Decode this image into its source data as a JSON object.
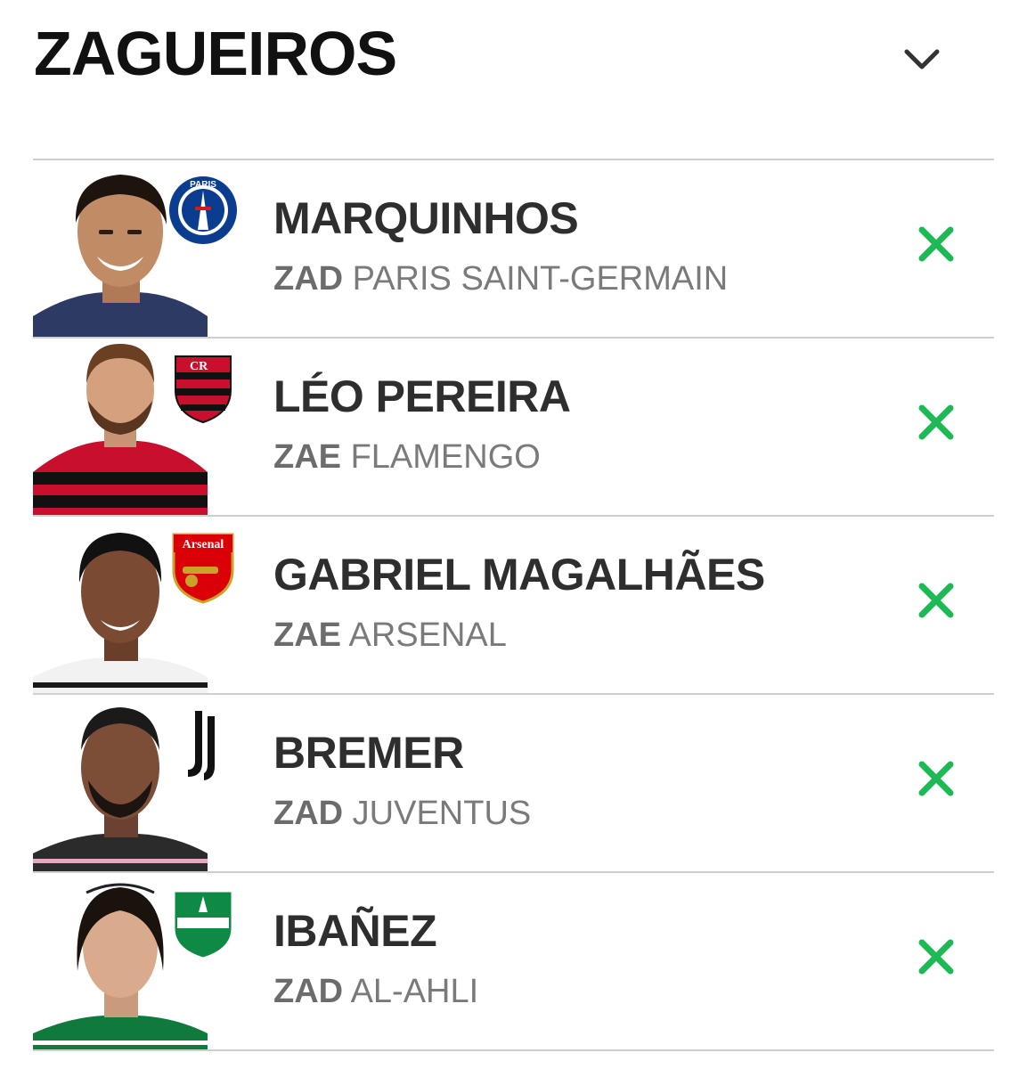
{
  "header": {
    "title": "ZAGUEIROS",
    "toggle_icon": "chevron-down-icon"
  },
  "colors": {
    "accent_remove": "#1db954",
    "divider": "#cfcfcf",
    "name_text": "#2e2e2e",
    "sub_text": "#7a7a7a"
  },
  "players": [
    {
      "name": "MARQUINHOS",
      "position": "ZAD",
      "club": "PARIS SAINT-GERMAIN",
      "crest_icon": "psg-crest-icon"
    },
    {
      "name": "LÉO PEREIRA",
      "position": "ZAE",
      "club": "FLAMENGO",
      "crest_icon": "flamengo-crest-icon"
    },
    {
      "name": "GABRIEL MAGALHÃES",
      "position": "ZAE",
      "club": "ARSENAL",
      "crest_icon": "arsenal-crest-icon",
      "crest_text": "Arsenal"
    },
    {
      "name": "BREMER",
      "position": "ZAD",
      "club": "JUVENTUS",
      "crest_icon": "juventus-crest-icon"
    },
    {
      "name": "IBAÑEZ",
      "position": "ZAD",
      "club": "AL-AHLI",
      "crest_icon": "al-ahli-crest-icon"
    }
  ]
}
